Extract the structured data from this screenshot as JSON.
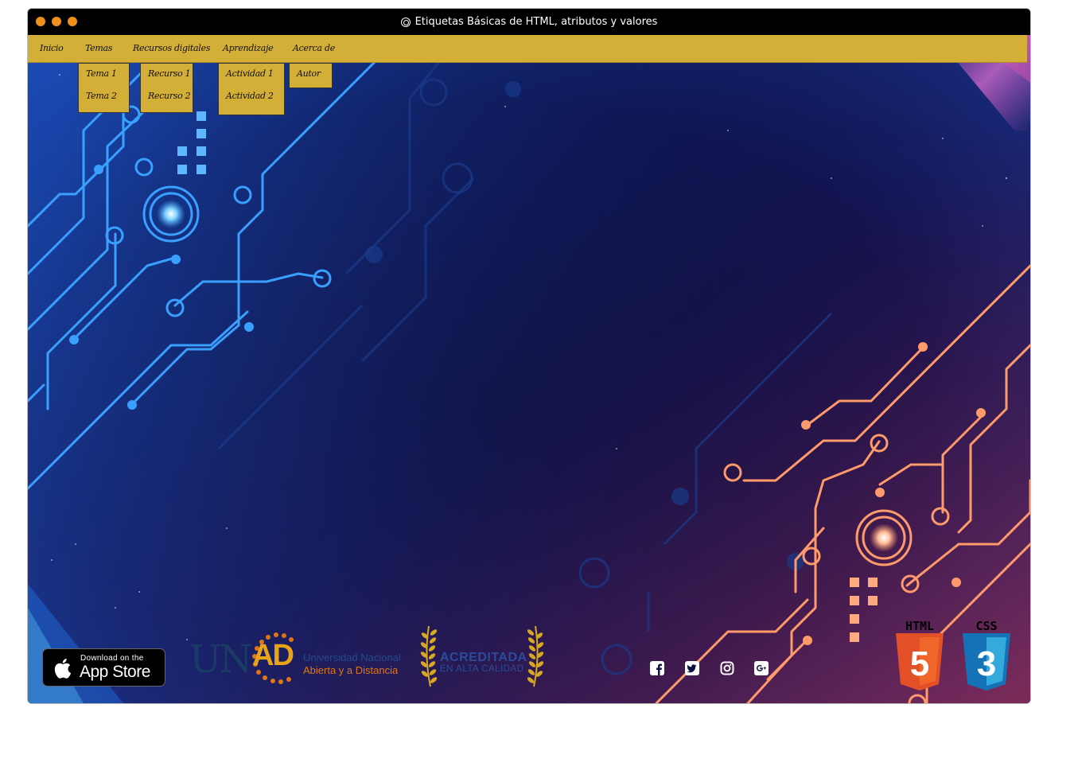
{
  "window": {
    "title": "Etiquetas Básicas de HTML, atributos y valores",
    "title_icon": "webcam-icon"
  },
  "nav": {
    "items": [
      {
        "label": "Inicio"
      },
      {
        "label": "Temas",
        "submenu": [
          "Tema 1",
          "Tema 2"
        ]
      },
      {
        "label": "Recursos digitales",
        "submenu": [
          "Recurso 1",
          "Recurso 2"
        ]
      },
      {
        "label": "Aprendizaje",
        "submenu": [
          "Actividad 1",
          "Actividad 2"
        ]
      },
      {
        "label": "Acerca de",
        "submenu": [
          "Autor"
        ]
      }
    ]
  },
  "footer": {
    "appstore": {
      "small": "Download on the",
      "big": "App Store"
    },
    "unad": {
      "line1": "Universidad Nacional",
      "line2": "Abierta y a Distancia"
    },
    "acreditada": {
      "line1": "ACREDITADA",
      "line2": "EN ALTA CALIDAD"
    },
    "social": [
      "facebook-icon",
      "twitter-icon",
      "instagram-icon",
      "google-plus-icon"
    ],
    "tech": [
      {
        "label": "HTML",
        "digit": "5"
      },
      {
        "label": "CSS",
        "digit": "3"
      }
    ]
  },
  "colors": {
    "nav_bg": "#d4af37",
    "titlebar": "#000000",
    "dot": "#f0901a",
    "circuit_blue": "#3aa0ff",
    "circuit_orange": "#ff9a6a",
    "background": "#06082a"
  }
}
